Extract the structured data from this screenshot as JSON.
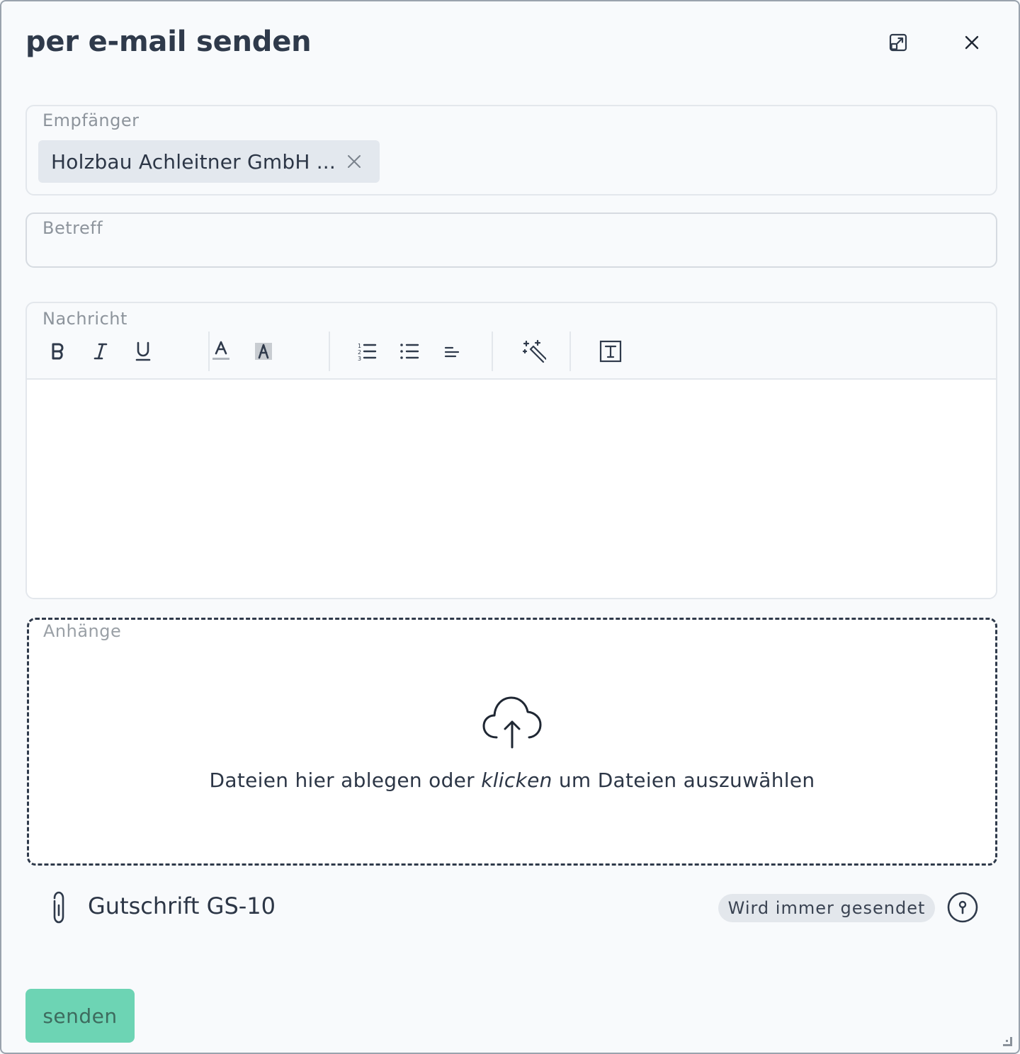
{
  "dialog": {
    "title": "per e-mail senden",
    "expand_icon": "expand-icon",
    "close_icon": "close-icon"
  },
  "recipient": {
    "label": "Empfänger",
    "chips": [
      {
        "text": "Holzbau Achleitner GmbH ..."
      }
    ]
  },
  "subject": {
    "label": "Betreff",
    "value": ""
  },
  "message": {
    "label": "Nachricht",
    "toolbar": [
      "bold-icon",
      "italic-icon",
      "underline-icon",
      "text-color-icon",
      "highlight-color-icon",
      "ordered-list-icon",
      "bullet-list-icon",
      "align-icon",
      "magic-wand-icon",
      "text-template-icon"
    ],
    "body": ""
  },
  "attachments": {
    "label": "Anhänge",
    "drop_text_before": "Dateien hier ablegen oder ",
    "drop_text_click": "klicken",
    "drop_text_after": " um Dateien auszuwählen",
    "files": [
      {
        "name": "Gutschrift GS-10",
        "badge": "Wird immer gesendet"
      }
    ]
  },
  "actions": {
    "send_label": "senden"
  },
  "colors": {
    "send_button": "#6dd4b4",
    "title": "#2f3a4b",
    "chip_bg": "#e3e8ee"
  }
}
